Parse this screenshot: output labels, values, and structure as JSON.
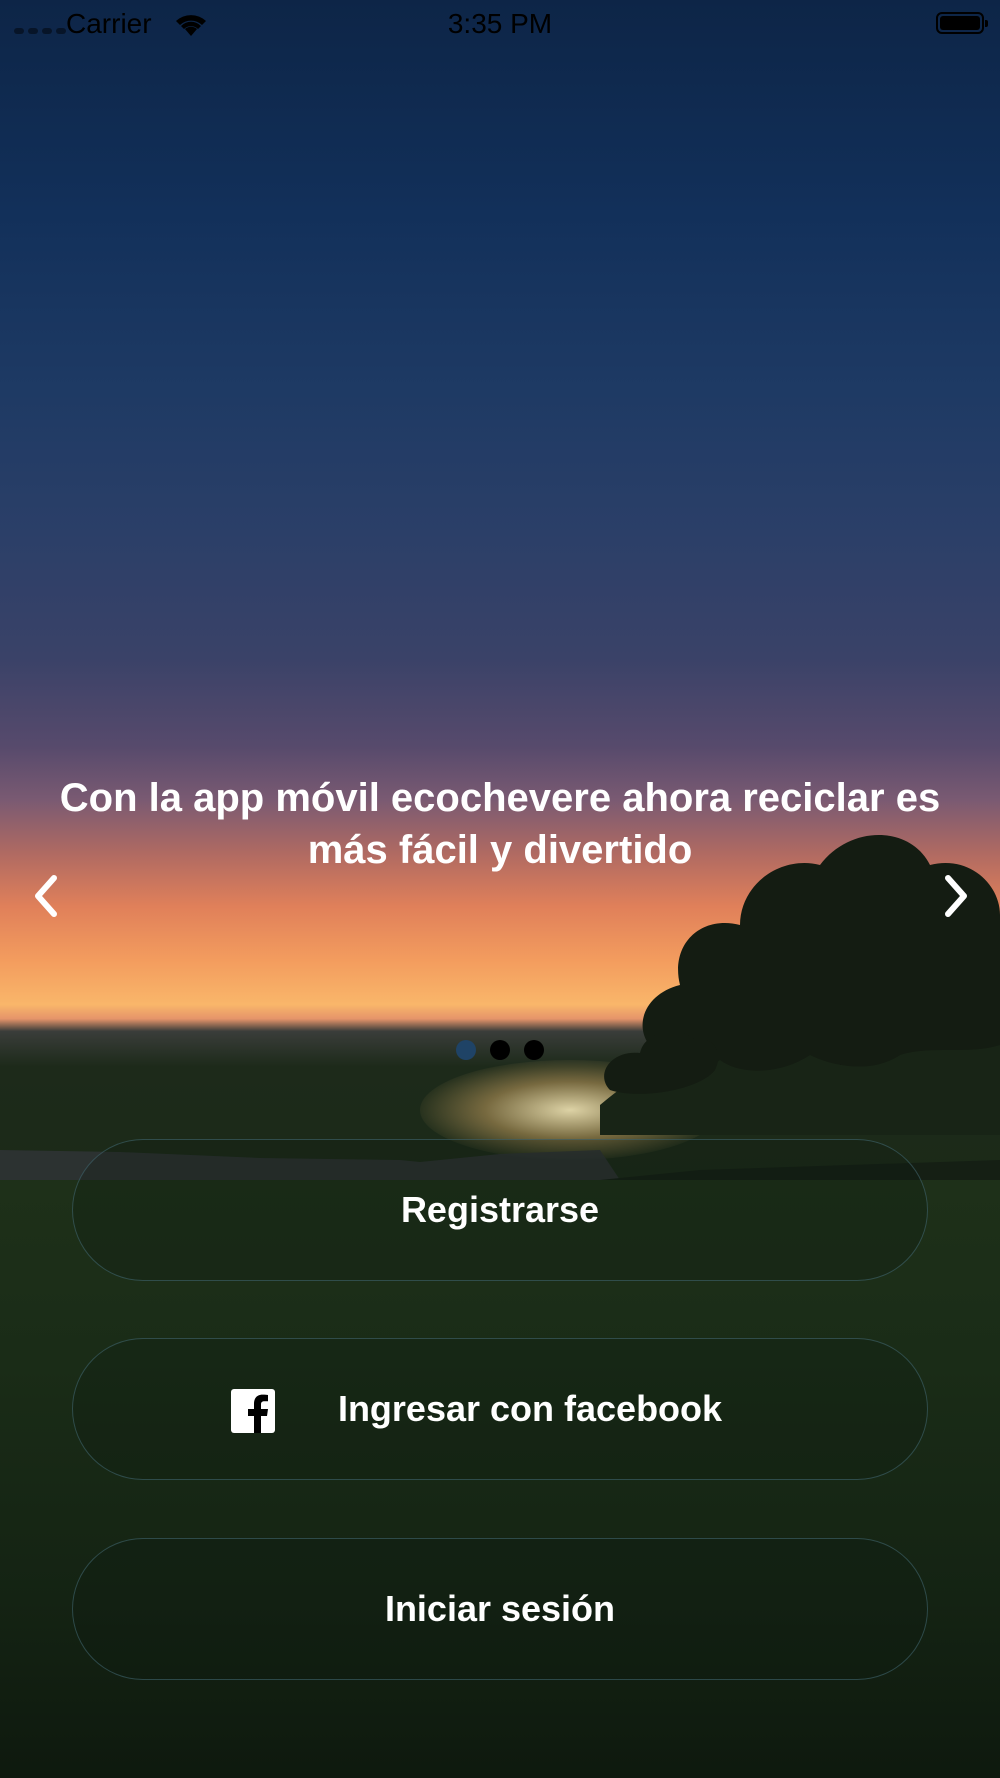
{
  "status_bar": {
    "carrier": "Carrier",
    "time": "3:35 PM"
  },
  "onboarding": {
    "headline": "Con la app móvil ecochevere ahora reciclar es más fácil y divertido",
    "prev_icon": "chevron-left-icon",
    "next_icon": "chevron-right-icon",
    "page_indicator": {
      "total": 3,
      "current": 1,
      "active_color": "#1f4366",
      "inactive_color": "#000000"
    }
  },
  "actions": {
    "register_label": "Registrarse",
    "facebook_label": "Ingresar con facebook",
    "facebook_icon": "facebook-icon",
    "login_label": "Iniciar sesión"
  },
  "colors": {
    "button_border": "#466e78",
    "text": "#ffffff"
  }
}
